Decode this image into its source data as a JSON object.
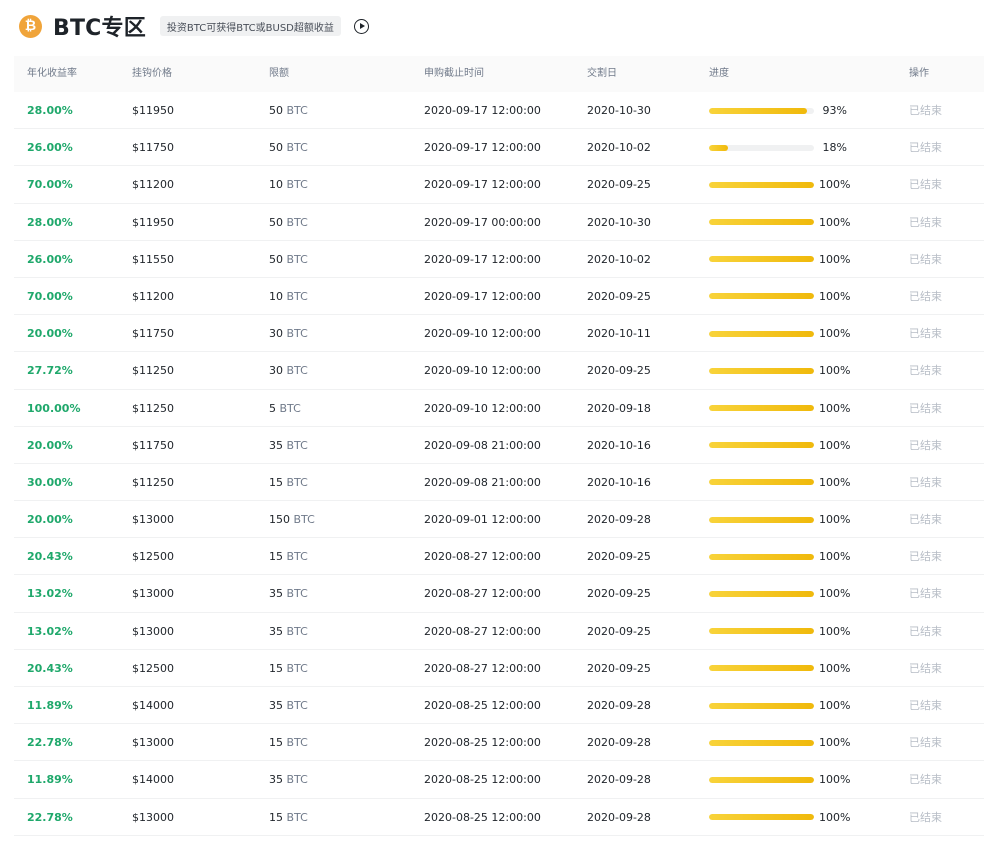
{
  "header": {
    "coin_symbol": "₿",
    "title": "BTC专区",
    "tag": "投资BTC可获得BTC或BUSD超额收益"
  },
  "table": {
    "columns": {
      "rate": "年化收益率",
      "price": "挂钩价格",
      "limit": "限额",
      "deadline": "申购截止时间",
      "delivery": "交割日",
      "progress": "进度",
      "action": "操作"
    },
    "rows": [
      {
        "rate": "28.00%",
        "price": "$11950",
        "limit_amount": "50",
        "limit_unit": "BTC",
        "deadline": "2020-09-17 12:00:00",
        "delivery": "2020-10-30",
        "progress_value": 93,
        "progress_text": "93%",
        "action": "已结束"
      },
      {
        "rate": "26.00%",
        "price": "$11750",
        "limit_amount": "50",
        "limit_unit": "BTC",
        "deadline": "2020-09-17 12:00:00",
        "delivery": "2020-10-02",
        "progress_value": 18,
        "progress_text": "18%",
        "action": "已结束"
      },
      {
        "rate": "70.00%",
        "price": "$11200",
        "limit_amount": "10",
        "limit_unit": "BTC",
        "deadline": "2020-09-17 12:00:00",
        "delivery": "2020-09-25",
        "progress_value": 100,
        "progress_text": "100%",
        "action": "已结束"
      },
      {
        "rate": "28.00%",
        "price": "$11950",
        "limit_amount": "50",
        "limit_unit": "BTC",
        "deadline": "2020-09-17 00:00:00",
        "delivery": "2020-10-30",
        "progress_value": 100,
        "progress_text": "100%",
        "action": "已结束"
      },
      {
        "rate": "26.00%",
        "price": "$11550",
        "limit_amount": "50",
        "limit_unit": "BTC",
        "deadline": "2020-09-17 12:00:00",
        "delivery": "2020-10-02",
        "progress_value": 100,
        "progress_text": "100%",
        "action": "已结束"
      },
      {
        "rate": "70.00%",
        "price": "$11200",
        "limit_amount": "10",
        "limit_unit": "BTC",
        "deadline": "2020-09-17 12:00:00",
        "delivery": "2020-09-25",
        "progress_value": 100,
        "progress_text": "100%",
        "action": "已结束"
      },
      {
        "rate": "20.00%",
        "price": "$11750",
        "limit_amount": "30",
        "limit_unit": "BTC",
        "deadline": "2020-09-10 12:00:00",
        "delivery": "2020-10-11",
        "progress_value": 100,
        "progress_text": "100%",
        "action": "已结束"
      },
      {
        "rate": "27.72%",
        "price": "$11250",
        "limit_amount": "30",
        "limit_unit": "BTC",
        "deadline": "2020-09-10 12:00:00",
        "delivery": "2020-09-25",
        "progress_value": 100,
        "progress_text": "100%",
        "action": "已结束"
      },
      {
        "rate": "100.00%",
        "price": "$11250",
        "limit_amount": "5",
        "limit_unit": "BTC",
        "deadline": "2020-09-10 12:00:00",
        "delivery": "2020-09-18",
        "progress_value": 100,
        "progress_text": "100%",
        "action": "已结束"
      },
      {
        "rate": "20.00%",
        "price": "$11750",
        "limit_amount": "35",
        "limit_unit": "BTC",
        "deadline": "2020-09-08 21:00:00",
        "delivery": "2020-10-16",
        "progress_value": 100,
        "progress_text": "100%",
        "action": "已结束"
      },
      {
        "rate": "30.00%",
        "price": "$11250",
        "limit_amount": "15",
        "limit_unit": "BTC",
        "deadline": "2020-09-08 21:00:00",
        "delivery": "2020-10-16",
        "progress_value": 100,
        "progress_text": "100%",
        "action": "已结束"
      },
      {
        "rate": "20.00%",
        "price": "$13000",
        "limit_amount": "150",
        "limit_unit": "BTC",
        "deadline": "2020-09-01 12:00:00",
        "delivery": "2020-09-28",
        "progress_value": 100,
        "progress_text": "100%",
        "action": "已结束"
      },
      {
        "rate": "20.43%",
        "price": "$12500",
        "limit_amount": "15",
        "limit_unit": "BTC",
        "deadline": "2020-08-27 12:00:00",
        "delivery": "2020-09-25",
        "progress_value": 100,
        "progress_text": "100%",
        "action": "已结束"
      },
      {
        "rate": "13.02%",
        "price": "$13000",
        "limit_amount": "35",
        "limit_unit": "BTC",
        "deadline": "2020-08-27 12:00:00",
        "delivery": "2020-09-25",
        "progress_value": 100,
        "progress_text": "100%",
        "action": "已结束"
      },
      {
        "rate": "13.02%",
        "price": "$13000",
        "limit_amount": "35",
        "limit_unit": "BTC",
        "deadline": "2020-08-27 12:00:00",
        "delivery": "2020-09-25",
        "progress_value": 100,
        "progress_text": "100%",
        "action": "已结束"
      },
      {
        "rate": "20.43%",
        "price": "$12500",
        "limit_amount": "15",
        "limit_unit": "BTC",
        "deadline": "2020-08-27 12:00:00",
        "delivery": "2020-09-25",
        "progress_value": 100,
        "progress_text": "100%",
        "action": "已结束"
      },
      {
        "rate": "11.89%",
        "price": "$14000",
        "limit_amount": "35",
        "limit_unit": "BTC",
        "deadline": "2020-08-25 12:00:00",
        "delivery": "2020-09-28",
        "progress_value": 100,
        "progress_text": "100%",
        "action": "已结束"
      },
      {
        "rate": "22.78%",
        "price": "$13000",
        "limit_amount": "15",
        "limit_unit": "BTC",
        "deadline": "2020-08-25 12:00:00",
        "delivery": "2020-09-28",
        "progress_value": 100,
        "progress_text": "100%",
        "action": "已结束"
      },
      {
        "rate": "11.89%",
        "price": "$14000",
        "limit_amount": "35",
        "limit_unit": "BTC",
        "deadline": "2020-08-25 12:00:00",
        "delivery": "2020-09-28",
        "progress_value": 100,
        "progress_text": "100%",
        "action": "已结束"
      },
      {
        "rate": "22.78%",
        "price": "$13000",
        "limit_amount": "15",
        "limit_unit": "BTC",
        "deadline": "2020-08-25 12:00:00",
        "delivery": "2020-09-28",
        "progress_value": 100,
        "progress_text": "100%",
        "action": "已结束"
      }
    ]
  },
  "colors": {
    "rate_green": "#1fa86b",
    "progress_yellow": "#f0b90b",
    "coin_orange": "#f0a43a",
    "ended_gray": "#b7bdc6"
  },
  "icons": {
    "coin": "bitcoin-icon",
    "play": "play-circle-icon"
  }
}
